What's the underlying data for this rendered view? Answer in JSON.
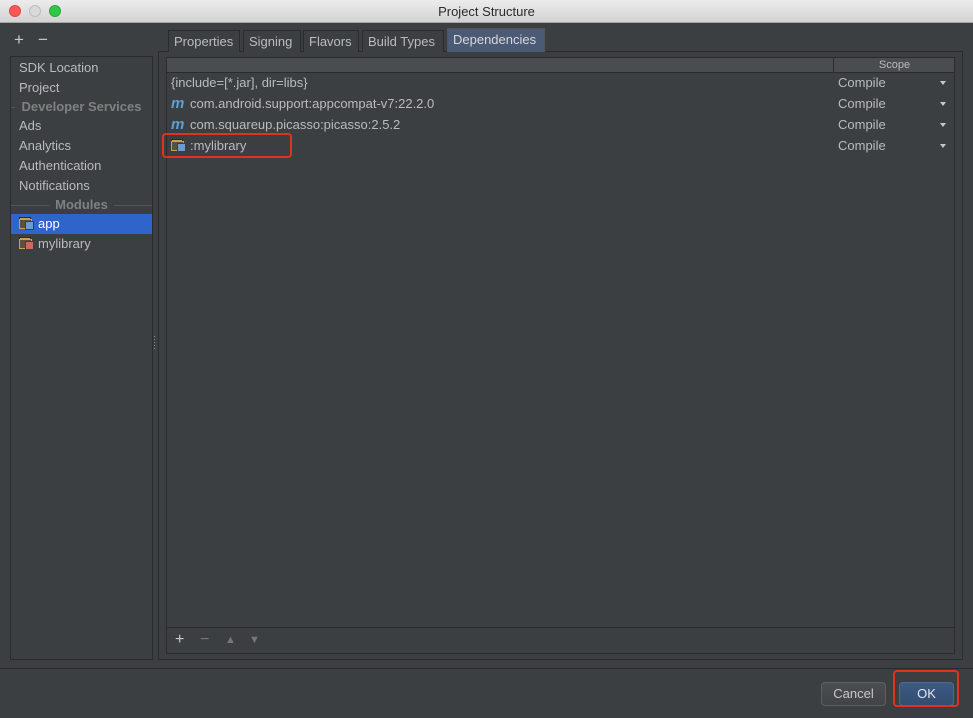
{
  "window": {
    "title": "Project Structure"
  },
  "left_toolbar": {
    "add": "+",
    "remove": "−"
  },
  "sidebar": {
    "items": [
      {
        "label": "SDK Location",
        "kind": "item"
      },
      {
        "label": "Project",
        "kind": "item"
      },
      {
        "label": "Developer Services",
        "kind": "section"
      },
      {
        "label": "Ads",
        "kind": "item"
      },
      {
        "label": "Analytics",
        "kind": "item"
      },
      {
        "label": "Authentication",
        "kind": "item"
      },
      {
        "label": "Notifications",
        "kind": "item"
      },
      {
        "label": "Modules",
        "kind": "section"
      },
      {
        "label": "app",
        "kind": "module",
        "selected": true
      },
      {
        "label": "mylibrary",
        "kind": "module",
        "selected": false
      }
    ]
  },
  "tabs": [
    {
      "label": "Properties",
      "active": false
    },
    {
      "label": "Signing",
      "active": false
    },
    {
      "label": "Flavors",
      "active": false
    },
    {
      "label": "Build Types",
      "active": false
    },
    {
      "label": "Dependencies",
      "active": true
    }
  ],
  "dependencies": {
    "scope_header": "Scope",
    "rows": [
      {
        "name": "{include=[*.jar], dir=libs}",
        "icon": "none",
        "scope": "Compile"
      },
      {
        "name": "com.android.support:appcompat-v7:22.2.0",
        "icon": "maven-icon",
        "scope": "Compile"
      },
      {
        "name": "com.squareup.picasso:picasso:2.5.2",
        "icon": "maven-icon",
        "scope": "Compile"
      },
      {
        "name": ":mylibrary",
        "icon": "module-icon",
        "scope": "Compile"
      }
    ],
    "maven_glyph": "m"
  },
  "table_toolbar": {
    "add": "+",
    "remove": "−",
    "up": "▲",
    "down": "▼"
  },
  "buttons": {
    "cancel": "Cancel",
    "ok": "OK"
  },
  "colors": {
    "selection": "#2f65ca",
    "highlight": "#e03221",
    "background": "#3c3f41"
  }
}
